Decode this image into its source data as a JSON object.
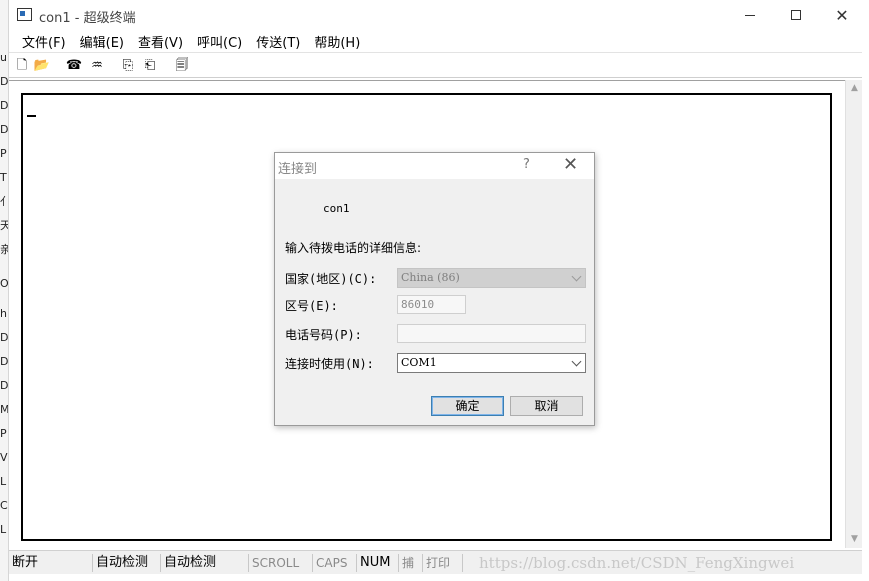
{
  "window": {
    "title": "con1 - 超级终端",
    "minimize_label": "",
    "close_label": "✕"
  },
  "menu": [
    {
      "label": "文件(F)"
    },
    {
      "label": "编辑(E)"
    },
    {
      "label": "查看(V)"
    },
    {
      "label": "呼叫(C)"
    },
    {
      "label": "传送(T)"
    },
    {
      "label": "帮助(H)"
    }
  ],
  "toolbar": [
    {
      "icon": "new-file-icon",
      "glyph": "🗋"
    },
    {
      "icon": "open-folder-icon",
      "glyph": "📂"
    },
    {
      "icon": "dial-icon",
      "glyph": "☎"
    },
    {
      "icon": "disconnect-icon",
      "glyph": "♒"
    },
    {
      "icon": "send-file-icon",
      "glyph": "⎘"
    },
    {
      "icon": "receive-file-icon",
      "glyph": "⎗"
    },
    {
      "icon": "properties-icon",
      "glyph": "🗐"
    }
  ],
  "background_window_letters": [
    "u",
    "D",
    "D",
    "D",
    "P",
    "T",
    "亻",
    "天",
    "亲",
    "O",
    "h",
    "D",
    "D",
    "D",
    "M",
    "P",
    "V",
    "L",
    "C",
    "L"
  ],
  "dialog": {
    "title": "连接到",
    "help": "?",
    "close": "✕",
    "connection_name": "con1",
    "instruction": "输入待拨电话的详细信息:",
    "country_label": "国家(地区)(C):",
    "country_value": "China (86)",
    "area_label": "区号(E):",
    "area_value": "86010",
    "phone_label": "电话号码(P):",
    "phone_value": "",
    "connect_label": "连接时使用(N):",
    "connect_value": "COM1",
    "ok_label": "确定",
    "cancel_label": "取消"
  },
  "statusbar": {
    "connection": "断开",
    "detect1": "自动检测",
    "detect2": "自动检测",
    "scroll": "SCROLL",
    "caps": "CAPS",
    "num": "NUM",
    "capture": "捕",
    "print": "打印"
  },
  "watermark": "https://blog.csdn.net/CSDN_FengXingwei"
}
